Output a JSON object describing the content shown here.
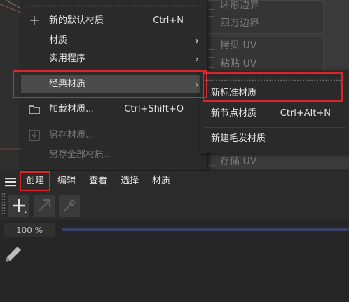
{
  "background_panel": {
    "items": [
      "环形边界",
      "四方边界",
      "拷贝 UV",
      "粘贴 UV",
      "存储 UV"
    ]
  },
  "main_menu": {
    "items": [
      {
        "label": "新的默认材质",
        "shortcut": "Ctrl+N",
        "icon": "plus-icon"
      },
      {
        "label": "材质",
        "submenu": true
      },
      {
        "label": "实用程序",
        "submenu": true
      },
      {
        "label": "经典材质",
        "submenu": true,
        "highlighted": true
      },
      {
        "label": "加载材质...",
        "shortcut": "Ctrl+Shift+O",
        "icon": "folder-icon"
      },
      {
        "label": "另存材质...",
        "disabled": true,
        "icon": "save-icon"
      },
      {
        "label": "另存全部材质...",
        "disabled": true
      }
    ]
  },
  "sub_menu": {
    "items": [
      {
        "label": "新标准材质",
        "highlighted": true
      },
      {
        "label": "新节点材质",
        "shortcut": "Ctrl+Alt+N"
      },
      {
        "label": "新建毛发材质"
      }
    ]
  },
  "tabs": [
    {
      "label": "创建",
      "active": true
    },
    {
      "label": "编辑"
    },
    {
      "label": "查看"
    },
    {
      "label": "选择"
    },
    {
      "label": "材质"
    }
  ],
  "toolbar": {
    "tools": [
      "plus-icon",
      "arrow-icon",
      "eyedropper-icon"
    ]
  },
  "zoom": {
    "label": "100 %"
  },
  "colors": {
    "highlight": "#e0232b",
    "menu_bg": "#2a2a2a",
    "hover_bg": "#4a4a4a"
  }
}
